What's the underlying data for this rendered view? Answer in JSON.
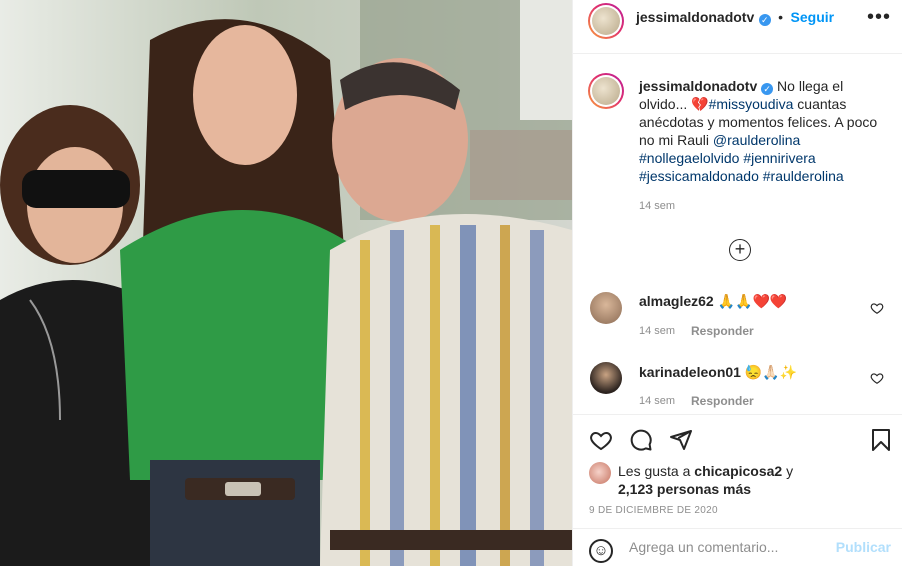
{
  "post": {
    "author": "jessimaldonadotv",
    "follow_label": "Seguir",
    "more_label": "•••",
    "verified_mark": "✓",
    "caption": {
      "text_before": "No llega el olvido... ",
      "broken_heart": "💔",
      "line_mid": " cuantas anécdotas y momentos felices. A poco no mi Rauli ",
      "tags": [
        "#missyoudiva",
        "@raulderolina",
        "#nollegaelolvido",
        "#jennirivera",
        "#jessicamaldonado",
        "#raulderolina"
      ],
      "time": "14 sem"
    },
    "load_more_label": "+"
  },
  "comments": [
    {
      "username": "almaglez62",
      "text": "🙏🙏❤️❤️",
      "time": "14 sem",
      "reply_label": "Responder"
    },
    {
      "username": "karinadeleon01",
      "text": "😓🙏🏻✨",
      "time": "14 sem",
      "reply_label": "Responder"
    }
  ],
  "likes": {
    "prefix": "Les gusta a ",
    "user": "chicapicosa2",
    "joiner": " y",
    "count_text": "2,123 personas más"
  },
  "date": "9 DE DICIEMBRE DE 2020",
  "composer": {
    "placeholder": "Agrega un comentario...",
    "publish_label": "Publicar",
    "emoji_icon": "☺"
  },
  "colors": {
    "link": "#00376b",
    "follow": "#0095f6",
    "like_red": "#ed4956",
    "muted": "#8e8e8e"
  }
}
